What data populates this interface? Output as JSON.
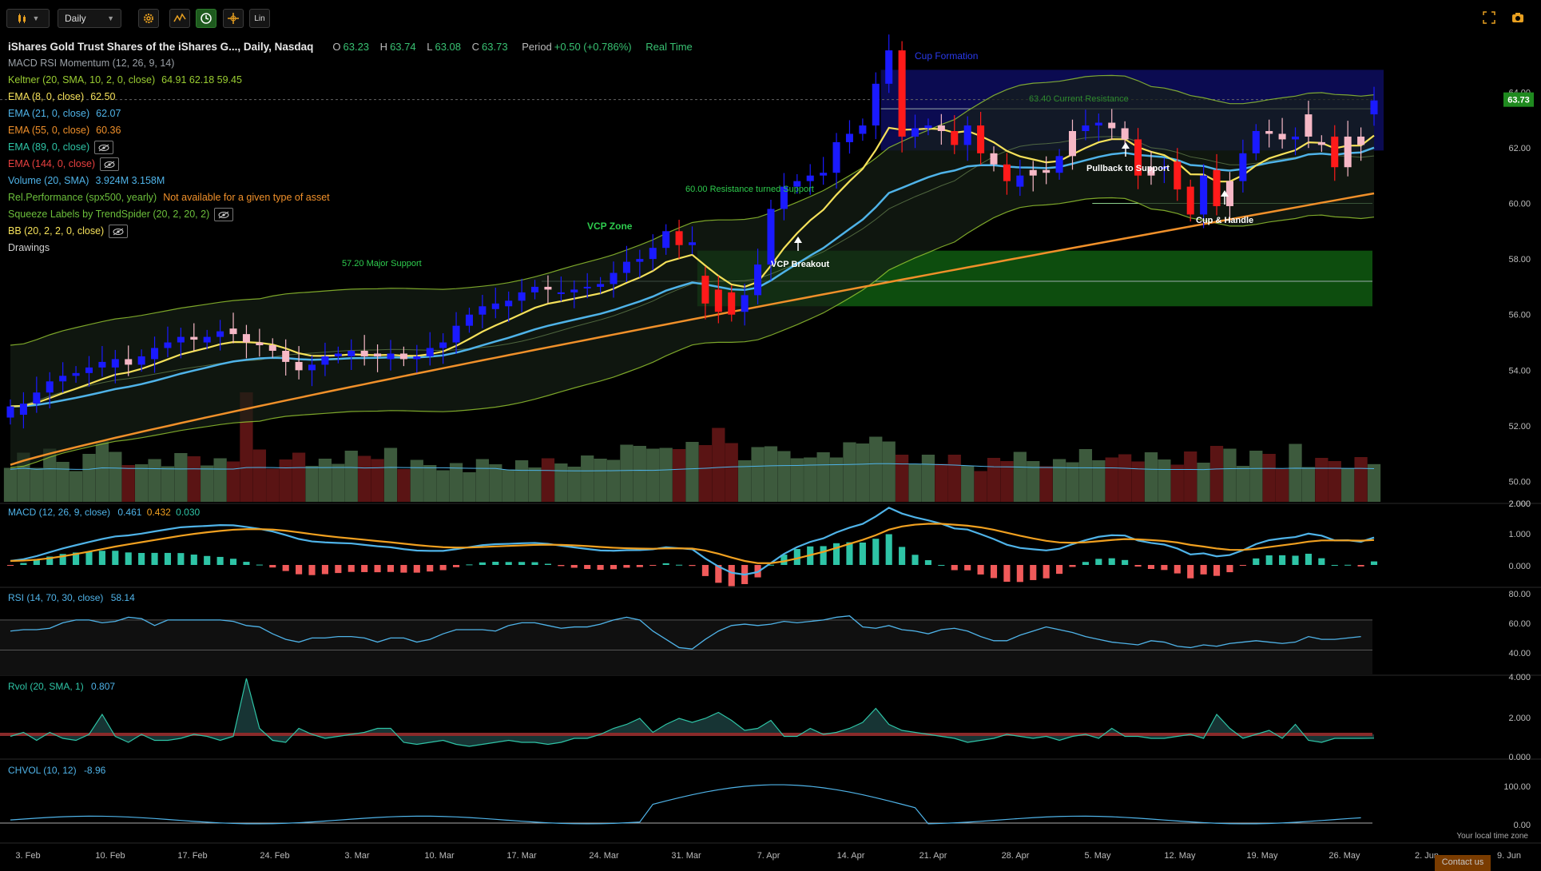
{
  "toolbar": {
    "chart_type_icon": "candlestick-icon",
    "interval": "Daily",
    "settings_icon": "gear-icon",
    "tool_icons": [
      "indicator-icon",
      "clock-icon",
      "crosshair-icon"
    ],
    "scale_label": "Lin",
    "fullscreen_icon": "fullscreen-icon",
    "camera_icon": "camera-icon"
  },
  "header": {
    "title": "iShares Gold Trust Shares of the iShares G..., Daily, Nasdaq",
    "open_label": "O",
    "open": "63.23",
    "high_label": "H",
    "high": "63.74",
    "low_label": "L",
    "low": "63.08",
    "close_label": "C",
    "close": "63.73",
    "period_label": "Period",
    "period": "+0.50 (+0.786%)",
    "realtime": "Real Time"
  },
  "indicators": [
    {
      "label": "MACD RSI Momentum (12, 26, 9, 14)",
      "values": "",
      "color": "#9aa0a6"
    },
    {
      "label": "Keltner (20, SMA, 10, 2, 0, close)",
      "values": "64.91  62.18  59.45",
      "color": "#9acd32"
    },
    {
      "label": "EMA (8, 0, close)",
      "values": "62.50",
      "color": "#f5e15a"
    },
    {
      "label": "EMA (21, 0, close)",
      "values": "62.07",
      "color": "#4fb3e8"
    },
    {
      "label": "EMA (55, 0, close)",
      "values": "60.36",
      "color": "#f0902a"
    },
    {
      "label": "EMA (89, 0, close)",
      "values": "",
      "color": "#2ec4a6",
      "hidden": true
    },
    {
      "label": "EMA (144, 0, close)",
      "values": "",
      "color": "#e84040",
      "hidden": true
    },
    {
      "label": "Volume (20, SMA)",
      "values": "3.924M  3.158M",
      "color": "#4fb3e8"
    },
    {
      "label": "Rel.Performance (spx500, yearly)",
      "values": "Not available for a given type of asset",
      "color": "#6cbf3c",
      "value_color": "#f0902a"
    },
    {
      "label": "Squeeze Labels by TrendSpider (20, 2, 20, 2)",
      "values": "",
      "color": "#6cbf3c",
      "hidden": true
    },
    {
      "label": "BB (20, 2, 2, 0, close)",
      "values": "",
      "color": "#f5e15a",
      "hidden": true
    },
    {
      "label": "Drawings",
      "values": "",
      "color": "#cfcfcf"
    }
  ],
  "sub_panels": {
    "macd": {
      "label": "MACD (12, 26, 9, close)",
      "v1": "0.461",
      "v2": "0.432",
      "v3": "0.030"
    },
    "rsi": {
      "label": "RSI (14, 70, 30, close)",
      "v1": "58.14"
    },
    "rvol": {
      "label": "Rvol (20, SMA, 1)",
      "v1": "0.807"
    },
    "chvol": {
      "label": "CHVOL (10, 12)",
      "v1": "-8.96"
    }
  },
  "annotations": {
    "cup_formation": "Cup Formation",
    "current_resistance": "63.40 Current Resistance",
    "pullback": "Pullback to Support",
    "cup_handle": "Cup & Handle",
    "resistance_support": "60.00 Resistance turned Support",
    "vcp_zone": "VCP Zone",
    "vcp_breakout": "VCP Breakout",
    "major_support": "57.20 Major Support"
  },
  "price_badge": "63.73",
  "local_time_note": "Your local time zone",
  "contact": "Contact us",
  "colors": {
    "up_candle": "#1a1aff",
    "down_candle": "#ff1a1a",
    "pink_candle": "#f6b8c6",
    "ema8": "#f5e15a",
    "ema21": "#4fb3e8",
    "ema55": "#f0902a",
    "keltner": "#9acd32",
    "vol_up": "#3d5a3d",
    "vol_down": "#5a1414",
    "macd_line": "#4fb3e8",
    "signal_line": "#f0a020",
    "green_zone": "#0f5a10",
    "blue_zone": "#0c0c5a"
  },
  "chart_data": {
    "type": "candlestick",
    "x_ticks": [
      "3. Feb",
      "10. Feb",
      "17. Feb",
      "24. Feb",
      "3. Mar",
      "10. Mar",
      "17. Mar",
      "24. Mar",
      "31. Mar",
      "7. Apr",
      "14. Apr",
      "21. Apr",
      "28. Apr",
      "5. May",
      "12. May",
      "19. May",
      "26. May",
      "2. Jun",
      "9. Jun"
    ],
    "y_ticks": [
      "64.00",
      "62.00",
      "60.00",
      "58.00",
      "56.00",
      "54.00",
      "52.00",
      "50.00"
    ],
    "ylim": [
      49.5,
      65.3
    ],
    "close": [
      52.7,
      52.8,
      53.2,
      53.6,
      53.8,
      53.9,
      54.1,
      54.3,
      54.4,
      54.2,
      54.5,
      54.8,
      55.0,
      55.2,
      55.1,
      55.2,
      55.4,
      55.3,
      55.0,
      54.9,
      54.7,
      54.3,
      54.0,
      54.2,
      54.5,
      54.6,
      54.7,
      54.5,
      54.5,
      54.6,
      54.4,
      54.5,
      54.8,
      55.0,
      55.6,
      56.0,
      56.3,
      56.4,
      56.5,
      56.8,
      57.0,
      56.9,
      56.8,
      56.9,
      57.0,
      57.1,
      57.5,
      57.9,
      58.0,
      58.4,
      59.0,
      58.5,
      58.6,
      56.4,
      56.1,
      56.0,
      56.7,
      57.8,
      59.8,
      60.6,
      60.8,
      61.0,
      61.1,
      62.2,
      62.5,
      62.8,
      64.3,
      65.5,
      62.4,
      62.7,
      62.8,
      62.6,
      62.1,
      62.8,
      61.8,
      61.4,
      60.8,
      61.0,
      61.2,
      61.1,
      61.7,
      62.6,
      62.8,
      62.9,
      62.7,
      62.3,
      61.0,
      61.3,
      61.3,
      60.5,
      59.6,
      61.0,
      59.9,
      60.8,
      61.8,
      62.6,
      62.5,
      62.3,
      62.4,
      63.2,
      62.1,
      61.3,
      62.4,
      62.1,
      63.7
    ],
    "open": [
      52.3,
      52.4,
      52.8,
      53.2,
      53.6,
      53.8,
      53.9,
      54.1,
      54.1,
      54.4,
      54.2,
      54.4,
      54.8,
      55.0,
      55.2,
      55.0,
      55.2,
      55.5,
      55.3,
      55.0,
      54.9,
      54.7,
      54.3,
      54.0,
      54.2,
      54.5,
      54.5,
      54.7,
      54.6,
      54.4,
      54.6,
      54.4,
      54.5,
      54.8,
      55.0,
      55.6,
      56.0,
      56.2,
      56.3,
      56.5,
      56.8,
      57.0,
      56.8,
      56.8,
      57.0,
      57.0,
      57.1,
      57.5,
      57.9,
      58.0,
      58.4,
      59.0,
      58.5,
      57.4,
      56.9,
      56.8,
      56.1,
      56.7,
      57.8,
      59.8,
      60.6,
      60.8,
      61.0,
      61.1,
      62.2,
      62.5,
      62.8,
      64.3,
      65.5,
      62.4,
      62.7,
      62.8,
      62.6,
      62.1,
      62.8,
      61.8,
      61.4,
      60.6,
      61.0,
      61.2,
      61.1,
      61.7,
      62.6,
      62.8,
      62.9,
      62.7,
      62.3,
      61.0,
      61.3,
      61.5,
      60.6,
      59.6,
      61.2,
      59.9,
      60.8,
      61.8,
      62.6,
      62.5,
      62.3,
      62.4,
      62.2,
      62.4,
      61.3,
      62.4,
      63.2
    ],
    "ema8_end": 62.5,
    "ema21_end": 62.07,
    "ema55_end": 60.36,
    "keltner_end": [
      64.91,
      62.18,
      59.45
    ],
    "levels": {
      "major_support": 57.2,
      "resistance_turned_support": 60.0,
      "current_resistance": 63.4
    },
    "zones": {
      "vcp_zone": [
        56.3,
        58.3
      ],
      "cup_zone": [
        61.9,
        64.8
      ]
    },
    "volume_axis": [
      "2.000"
    ],
    "macd_axis": [
      "2.000",
      "1.000",
      "0.000"
    ],
    "rsi_axis": [
      "80.00",
      "60.00",
      "40.00"
    ],
    "rvol_axis": [
      "4.000",
      "2.000",
      "0.000"
    ],
    "chvol_axis": [
      "100.00",
      "0.00"
    ],
    "rsi": [
      62,
      63,
      63,
      64,
      68,
      70,
      70,
      68,
      69,
      72,
      71,
      66,
      70,
      70,
      70,
      70,
      70,
      69,
      66,
      65,
      60,
      56,
      54,
      57,
      57,
      58,
      58,
      57,
      54,
      57,
      57,
      54,
      56,
      60,
      63,
      63,
      63,
      62,
      66,
      68,
      68,
      66,
      64,
      65,
      65,
      67,
      70,
      72,
      70,
      62,
      56,
      50,
      49,
      56,
      62,
      66,
      67,
      66,
      67,
      69,
      68,
      69,
      70,
      72,
      73,
      65,
      64,
      66,
      63,
      62,
      60,
      63,
      64,
      62,
      58,
      55,
      55,
      59,
      62,
      65,
      63,
      61,
      58,
      56,
      54,
      53,
      52,
      55,
      54,
      51,
      50,
      52,
      51,
      53,
      54,
      55,
      54,
      53,
      54,
      58,
      56,
      56,
      57,
      58
    ],
    "rvol": [
      0.9,
      1.1,
      0.7,
      1.1,
      0.8,
      0.7,
      1.0,
      2.0,
      0.9,
      0.6,
      1.0,
      0.7,
      0.7,
      0.8,
      1.0,
      0.9,
      0.7,
      0.9,
      3.8,
      1.3,
      0.7,
      0.6,
      1.3,
      1.0,
      0.8,
      0.9,
      1.0,
      1.1,
      1.3,
      1.3,
      0.6,
      0.5,
      0.6,
      0.7,
      0.5,
      0.4,
      0.5,
      0.6,
      0.7,
      0.6,
      0.6,
      0.5,
      0.6,
      0.8,
      0.8,
      1.0,
      1.3,
      1.5,
      1.8,
      1.1,
      1.5,
      1.8,
      1.6,
      1.8,
      2.1,
      1.7,
      1.2,
      1.3,
      1.7,
      0.9,
      0.9,
      1.3,
      1.0,
      1.1,
      1.3,
      1.6,
      2.3,
      1.5,
      1.2,
      1.1,
      1.0,
      0.9,
      0.8,
      0.6,
      0.7,
      0.8,
      1.0,
      0.9,
      0.8,
      0.9,
      0.7,
      0.9,
      1.0,
      0.8,
      1.3,
      0.9,
      0.9,
      0.8,
      0.8,
      0.9,
      1.0,
      0.8,
      2.0,
      1.3,
      0.8,
      1.0,
      1.2,
      0.8,
      1.5,
      0.7,
      0.6,
      0.8,
      0.8,
      0.8,
      0.807
    ]
  }
}
